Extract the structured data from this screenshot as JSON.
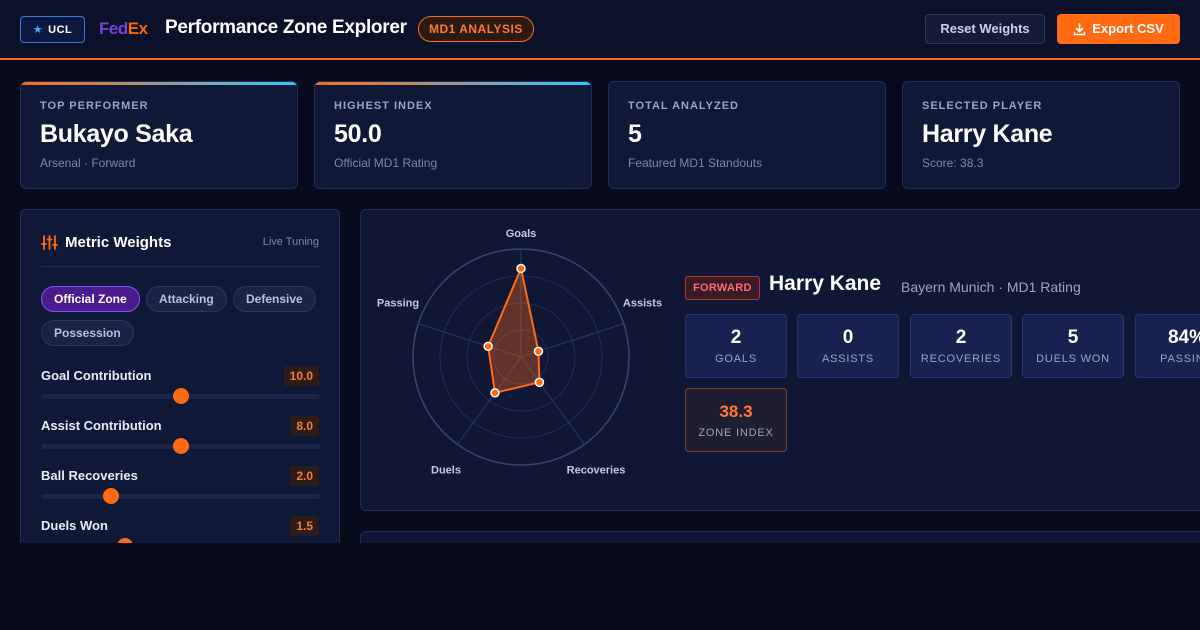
{
  "header": {
    "ucl_label": "UCL",
    "fedex_fed": "Fed",
    "fedex_ex": "Ex",
    "title": "Performance Zone Explorer",
    "badge": "MD1 ANALYSIS",
    "reset_label": "Reset Weights",
    "export_label": "Export CSV"
  },
  "stats": [
    {
      "label": "TOP PERFORMER",
      "value": "Bukayo Saka",
      "sub": "Arsenal · Forward"
    },
    {
      "label": "HIGHEST INDEX",
      "value": "50.0",
      "sub": "Official MD1 Rating"
    },
    {
      "label": "TOTAL ANALYZED",
      "value": "5",
      "sub": "Featured MD1 Standouts"
    },
    {
      "label": "SELECTED PLAYER",
      "value": "Harry Kane",
      "sub": "Score: 38.3"
    }
  ],
  "weights": {
    "title": "Metric Weights",
    "tag": "Live Tuning",
    "presets": [
      {
        "label": "Official Zone",
        "active": true
      },
      {
        "label": "Attacking",
        "active": false
      },
      {
        "label": "Defensive",
        "active": false
      },
      {
        "label": "Possession",
        "active": false
      }
    ],
    "metrics": [
      {
        "label": "Goal Contribution",
        "value": "10.0",
        "level": 0.5
      },
      {
        "label": "Assist Contribution",
        "value": "8.0",
        "level": 0.5
      },
      {
        "label": "Ball Recoveries",
        "value": "2.0",
        "level": 0.25
      },
      {
        "label": "Duels Won",
        "value": "1.5",
        "level": 0.3
      }
    ]
  },
  "radar": {
    "axes": [
      "Goals",
      "Assists",
      "Recoveries",
      "Duels",
      "Passing"
    ],
    "values": [
      0.82,
      0.17,
      0.29,
      0.41,
      0.32
    ],
    "fill_color": "#ff6a13"
  },
  "player": {
    "position": "FORWARD",
    "name": "Harry Kane",
    "meta": "Bayern Munich · MD1 Rating",
    "stats": [
      {
        "value": "2",
        "label": "GOALS"
      },
      {
        "value": "0",
        "label": "ASSISTS"
      },
      {
        "value": "2",
        "label": "RECOVERIES"
      },
      {
        "value": "5",
        "label": "DUELS WON"
      },
      {
        "value": "84%",
        "label": "PASSING"
      }
    ],
    "zone_index": "38.3",
    "zone_label": "ZONE INDEX"
  }
}
